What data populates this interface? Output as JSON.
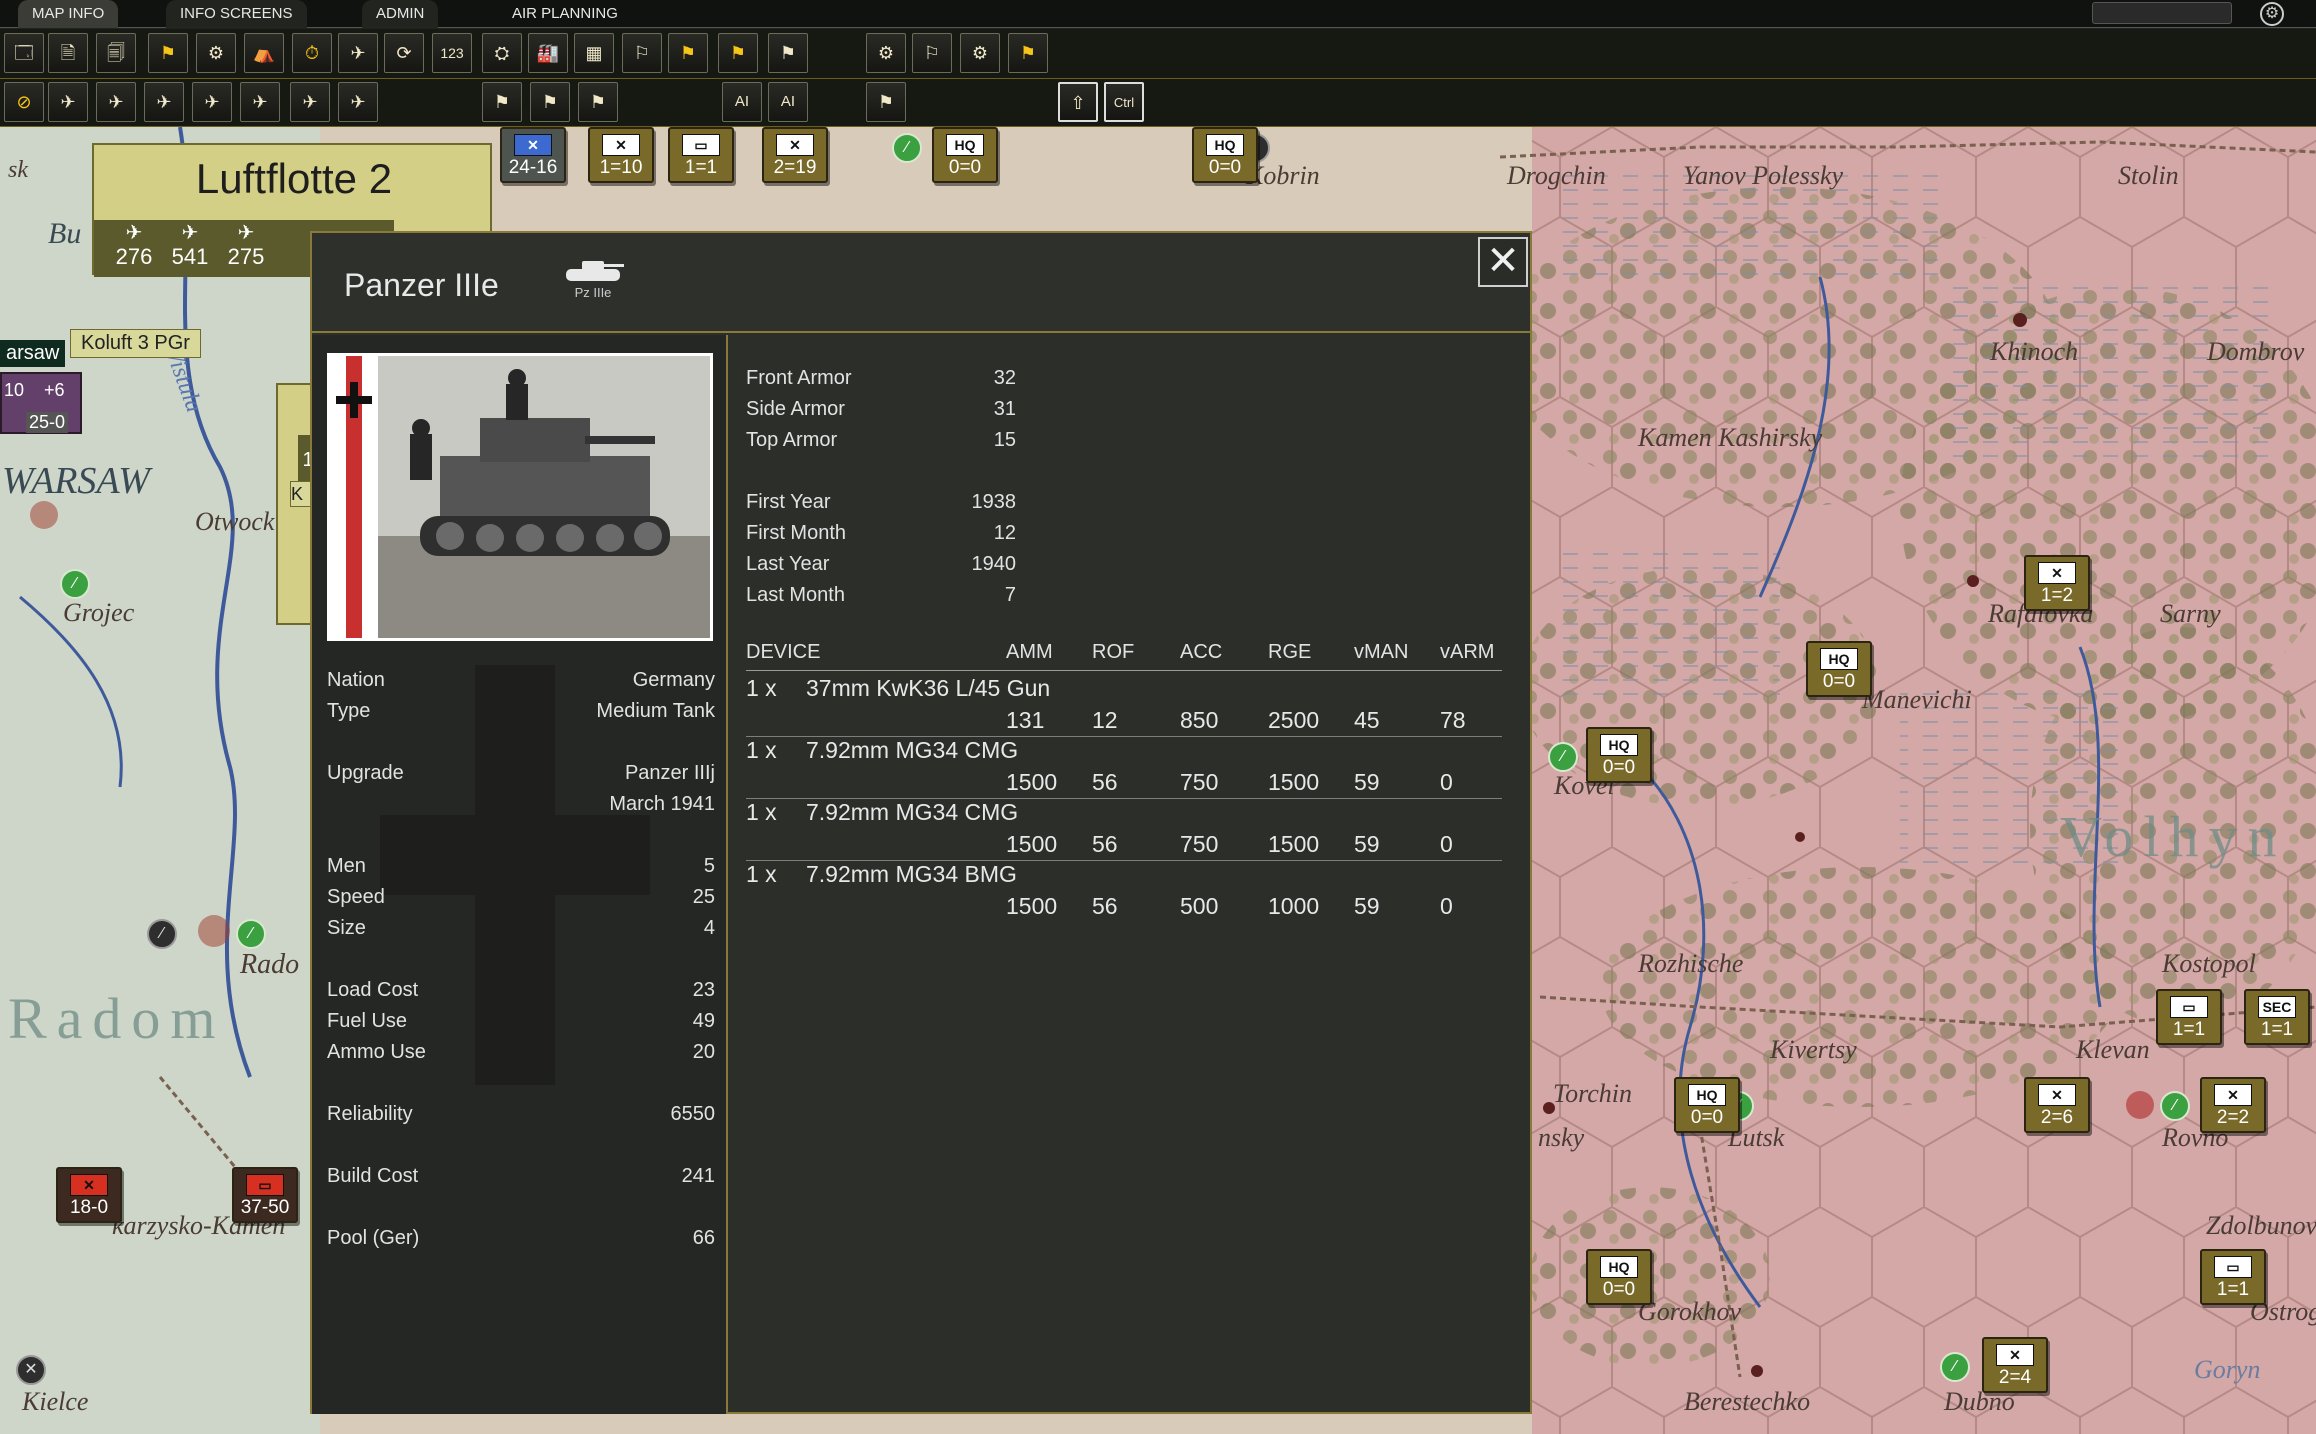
{
  "tabs": [
    {
      "label": "MAP INFO"
    },
    {
      "label": "INFO SCREENS"
    },
    {
      "label": "ADMIN"
    },
    {
      "label": "AIR PLANNING"
    }
  ],
  "toolbar": {
    "icons1": [
      "🗔",
      "🗎",
      "🗐",
      "⚑",
      "⚙",
      "⛺",
      "⏱",
      "✈",
      "⟳",
      "123",
      "⛭",
      "🏭",
      "▦",
      "⚐",
      "⚑",
      "⚑",
      "⚑",
      "⚙",
      "⚐",
      "⚙",
      "⚑"
    ],
    "icons2": [
      "⊘",
      "✈",
      "✈",
      "✈",
      "✈",
      "✈",
      "✈",
      "✈",
      "⚑",
      "⚑",
      "⚑",
      "AI",
      "AI",
      "⚑",
      "⇧",
      "Ctrl"
    ]
  },
  "air_hq": {
    "name": "Luftflotte 2",
    "stats": [
      "276",
      "541",
      "275"
    ]
  },
  "map": {
    "labels": [
      "Bu",
      "WARSAW",
      "Otwock",
      "Grojec",
      "Rado",
      "Radom",
      "Kielce",
      "karzysko-Kamen",
      "Kobrin",
      "Drogchin",
      "Yanov Polessky",
      "Stolin",
      "Khinoch",
      "Dombrov",
      "Kamen Kashirsky",
      "Rafalovka",
      "Sarny",
      "Manevichi",
      "Kovel",
      "Volhyn",
      "Rozhische",
      "Kostopol",
      "Kivertsy",
      "Klevan",
      "Torchin",
      "nsky",
      "Lutsk",
      "Rovno",
      "Zdolbunov",
      "Gorokhov",
      "Ostrog",
      "Goryn",
      "Berestechko",
      "Dubno",
      "Vistula"
    ],
    "counters": {
      "c1": {
        "sym": "✕",
        "val": "1=10"
      },
      "c2": {
        "sym": "▭",
        "val": "1=1"
      },
      "c3": {
        "sym": "✕",
        "val": "2=19"
      },
      "c4": {
        "sym": "HQ",
        "val": "0=0"
      },
      "c5": {
        "sym": "HQ",
        "val": "0=0"
      },
      "c6": {
        "sym": "✕",
        "val": "24-16"
      },
      "c7": {
        "sym": "✕",
        "val": "1=2"
      },
      "c8": {
        "sym": "HQ",
        "val": "0=0"
      },
      "c9": {
        "sym": "HQ",
        "val": "0=0"
      },
      "c10": {
        "sym": "▭",
        "val": "1=1"
      },
      "c11": {
        "sym": "SEC",
        "val": "1=1"
      },
      "c12": {
        "sym": "HQ",
        "val": "0=0"
      },
      "c13": {
        "sym": "✕",
        "val": "2=6"
      },
      "c14": {
        "sym": "✕",
        "val": "2=2"
      },
      "c15": {
        "sym": "HQ",
        "val": "0=0"
      },
      "c16": {
        "sym": "▭",
        "val": "1=1"
      },
      "c17": {
        "sym": "✕",
        "val": "2=4"
      },
      "c18": {
        "sym": "✕",
        "val": "18-0"
      },
      "c19": {
        "sym": "▭",
        "val": "37-50"
      }
    },
    "koluft": "Koluft 3 PGr",
    "warsaw_tag": "arsaw",
    "warsaw_counter": {
      "a": "10",
      "b": "+6",
      "c": "25-0"
    },
    "partial": [
      "1",
      "K"
    ]
  },
  "dialog": {
    "title": "Panzer IIIe",
    "icon_caption": "Pz IIIe",
    "close_label": "✕",
    "nation": {
      "label": "Nation",
      "value": "Germany"
    },
    "type": {
      "label": "Type",
      "value": "Medium Tank"
    },
    "upgrade": {
      "label": "Upgrade",
      "value": "Panzer IIIj",
      "date": "March 1941"
    },
    "men": {
      "label": "Men",
      "value": "5"
    },
    "speed": {
      "label": "Speed",
      "value": "25"
    },
    "size": {
      "label": "Size",
      "value": "4"
    },
    "load_cost": {
      "label": "Load Cost",
      "value": "23"
    },
    "fuel_use": {
      "label": "Fuel Use",
      "value": "49"
    },
    "ammo_use": {
      "label": "Ammo Use",
      "value": "20"
    },
    "reliability": {
      "label": "Reliability",
      "value": "6550"
    },
    "build_cost": {
      "label": "Build Cost",
      "value": "241"
    },
    "pool": {
      "label": "Pool (Ger)",
      "value": "66"
    },
    "front_armor": {
      "label": "Front Armor",
      "value": "32"
    },
    "side_armor": {
      "label": "Side Armor",
      "value": "31"
    },
    "top_armor": {
      "label": "Top Armor",
      "value": "15"
    },
    "first_year": {
      "label": "First Year",
      "value": "1938"
    },
    "first_month": {
      "label": "First Month",
      "value": "12"
    },
    "last_year": {
      "label": "Last Year",
      "value": "1940"
    },
    "last_month": {
      "label": "Last Month",
      "value": "7"
    },
    "device_headers": [
      "DEVICE",
      "AMM",
      "ROF",
      "ACC",
      "RGE",
      "vMAN",
      "vARM"
    ],
    "devices": [
      {
        "qty": "1 x",
        "name": "37mm KwK36 L/45 Gun",
        "amm": "131",
        "rof": "12",
        "acc": "850",
        "rge": "2500",
        "vman": "45",
        "varm": "78"
      },
      {
        "qty": "1 x",
        "name": "7.92mm MG34 CMG",
        "amm": "1500",
        "rof": "56",
        "acc": "750",
        "rge": "1500",
        "vman": "59",
        "varm": "0"
      },
      {
        "qty": "1 x",
        "name": "7.92mm MG34 CMG",
        "amm": "1500",
        "rof": "56",
        "acc": "750",
        "rge": "1500",
        "vman": "59",
        "varm": "0"
      },
      {
        "qty": "1 x",
        "name": "7.92mm MG34 BMG",
        "amm": "1500",
        "rof": "56",
        "acc": "500",
        "rge": "1000",
        "vman": "59",
        "varm": "0"
      }
    ]
  }
}
